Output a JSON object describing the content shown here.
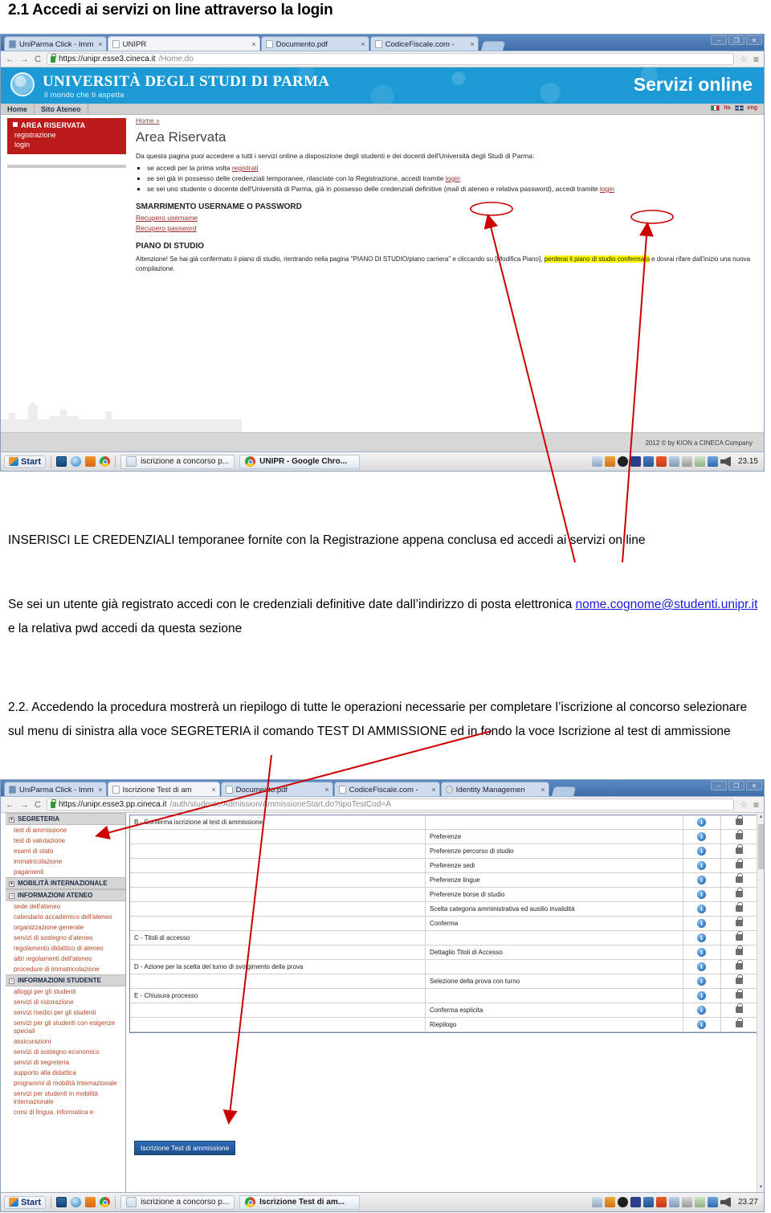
{
  "page": {
    "heading": "2.1 Accedi ai servizi on line attraverso la login"
  },
  "colors": {
    "accent_red": "#bb1b1b",
    "banner_blue": "#1b9ad6",
    "link_red": "#9b2d2d",
    "annotation_red": "#cc0000",
    "highlight_yellow": "#ffff00",
    "button_blue": "#2f6db5"
  },
  "screenshot1": {
    "tabs": [
      {
        "title": "UniParma Click - Imm",
        "close": "×",
        "favicon": "image-icon",
        "active": false
      },
      {
        "title": "UNIPR",
        "close": "×",
        "favicon": "document-icon",
        "active": true
      },
      {
        "title": "Documento.pdf",
        "close": "×",
        "favicon": "document-icon",
        "active": false
      },
      {
        "title": "CodiceFiscale.com -",
        "close": "×",
        "favicon": "document-icon",
        "active": false
      }
    ],
    "window_controls": {
      "minimize": "–",
      "maximize": "❐",
      "close": "✕"
    },
    "nav": {
      "back": "←",
      "forward": "→",
      "reload": "C"
    },
    "url": {
      "scheme_host": "https://unipr.esse3.cineca.it",
      "path": "/Home.do",
      "lock": "lock-icon"
    },
    "bookmark_star": "☆",
    "chrome_menu": "≡",
    "site": {
      "university": "UNIVERSITÀ DEGLI STUDI DI PARMA",
      "tagline": "il mondo che ti aspetta",
      "servizi": "Servizi online",
      "nav_items": [
        "Home",
        "Sito Ateneo"
      ],
      "lang_it": "ita",
      "lang_en": "eng",
      "sidebar": {
        "title": "AREA RISERVATA",
        "items": [
          "registrazione",
          "login"
        ]
      },
      "breadcrumb": "Home »",
      "page_title": "Area Riservata",
      "intro": "Da questa pagina puoi accedere a tutti i servizi online a disposizione degli studenti e dei docenti dell'Università degli Studi di Parma:",
      "bullets": [
        {
          "pre": "se accedi per la prima volta ",
          "link": "registrati",
          "post": ""
        },
        {
          "pre": "se sei già in possesso delle credenziali temporanee, rilasciate con la Registrazione, accedi tramite ",
          "link": "login",
          "post": ""
        },
        {
          "pre": "se sei uno studente o docente dell'Università di Parma, già in possesso delle credenziali definitive (mail di ateneo e relativa password), accedi tramite ",
          "link": "login",
          "post": ""
        }
      ],
      "section_smarrimento": "SMARRIMENTO USERNAME O PASSWORD",
      "recovery_links": [
        "Recupero username",
        "Recupero password"
      ],
      "section_piano": "PIANO DI STUDIO",
      "attention_pre": "Attenzione! Se hai già confermato il piano di studio, rientrando nella pagina \"PIANO DI STUDIO/piano carriera\" e cliccando su [Modifica Piano], ",
      "attention_highlight": "perderai il piano di studio confermato",
      "attention_post": " e dovrai rifare dall'inizio una nuova compilazione.",
      "footer": "2012 © by KION a CINECA Company"
    },
    "taskbar": {
      "start": "Start",
      "quick_launch": [
        "show-desktop-icon",
        "internet-explorer-icon",
        "media-player-icon",
        "chrome-icon"
      ],
      "items": [
        {
          "label": "iscrizione a concorso p...",
          "icon": "word-document-icon",
          "active": false
        },
        {
          "label": "UNIPR - Google Chro...",
          "icon": "chrome-icon",
          "active": true
        }
      ],
      "clock": "23.15"
    }
  },
  "body_text": {
    "para1": "INSERISCI LE CREDENZIALI temporanee fornite con la Registrazione appena conclusa ed accedi ai servizi on line",
    "para2_pre": "Se sei un utente già registrato accedi con le credenziali definitive date dall’indirizzo di posta elettronica ",
    "para2_link": "nome.cognome@studenti.unipr.it",
    "para2_post": " e la relativa pwd accedi da questa sezione",
    "para3": "2.2. Accedendo la procedura mostrerà un riepilogo di tutte le operazioni necessarie per completare l’iscrizione al concorso selezionare sul menu di sinistra alla voce SEGRETERIA il comando TEST DI AMMISSIONE ed in fondo la voce Iscrizione al test di ammissione"
  },
  "screenshot2": {
    "tabs": [
      {
        "title": "UniParma Click - Imm",
        "close": "×",
        "favicon": "image-icon",
        "active": false
      },
      {
        "title": "Iscrizione Test di am",
        "close": "×",
        "favicon": "document-icon",
        "active": true
      },
      {
        "title": "Documento.pdf",
        "close": "×",
        "favicon": "document-icon",
        "active": false
      },
      {
        "title": "CodiceFiscale.com -",
        "close": "×",
        "favicon": "document-icon",
        "active": false
      },
      {
        "title": "Identity Managemen",
        "close": "×",
        "favicon": "identity-icon",
        "active": false
      }
    ],
    "window_controls": {
      "minimize": "–",
      "maximize": "❐",
      "close": "✕"
    },
    "nav": {
      "back": "←",
      "forward": "→",
      "reload": "C"
    },
    "url": {
      "scheme_host": "https://unipr.esse3.pp.cineca.it",
      "path": "/auth/studente/Admission/AmmissioneStart.do?tipoTestCod=A",
      "lock": "lock-icon"
    },
    "bookmark_star": "☆",
    "chrome_menu": "≡",
    "sidebar_groups": [
      {
        "title": "SEGRETERIA",
        "toggle": "+",
        "items": [
          "test di ammissione",
          "test di valutazione",
          "esami di stato",
          "immatricolazione",
          "pagamenti"
        ]
      },
      {
        "title": "MOBILITÀ INTERNAZIONALE",
        "toggle": "+",
        "items": []
      },
      {
        "title": "INFORMAZIONI ATENEO",
        "toggle": "-",
        "items": [
          "sede dell'ateneo",
          "calendario accademico dell'ateneo",
          "organizzazione generale",
          "servizi di sostegno d'ateneo",
          "regolamento didattico di ateneo",
          "altri regolamenti dell'ateneo",
          "procedure di immatricolazione"
        ]
      },
      {
        "title": "INFORMAZIONI STUDENTE",
        "toggle": "-",
        "items": [
          "alloggi per gli studenti",
          "servizi di ristorazione",
          "servizi medici per gli studenti",
          "servizi per gli studenti con esigenze speciali",
          "assicurazioni",
          "servizi di sostegno economico",
          "servizi di segreteria",
          "supporto alla didattica",
          "programmi di mobilità internazionale",
          "servizi per studenti in mobilità internazionale",
          "corsi di lingua, informatica e"
        ]
      }
    ],
    "table": {
      "rows": [
        {
          "c1": "B - Conferma iscrizione al test di ammissione",
          "c2": "",
          "info": "i",
          "lock": "lock-icon"
        },
        {
          "c1": "",
          "c2": "Preferenze",
          "info": "i",
          "lock": "lock-icon"
        },
        {
          "c1": "",
          "c2": "Preferenze percorso di studio",
          "info": "i",
          "lock": "lock-icon"
        },
        {
          "c1": "",
          "c2": "Preferenze sedi",
          "info": "i",
          "lock": "lock-icon"
        },
        {
          "c1": "",
          "c2": "Preferenze lingue",
          "info": "i",
          "lock": "lock-icon"
        },
        {
          "c1": "",
          "c2": "Preferenze borse di studio",
          "info": "i",
          "lock": "lock-icon"
        },
        {
          "c1": "",
          "c2": "Scelta categoria amministrativa ed ausilio invalidità",
          "info": "i",
          "lock": "lock-icon"
        },
        {
          "c1": "",
          "c2": "Conferma",
          "info": "i",
          "lock": "lock-icon"
        },
        {
          "c1": "C - Titoli di accesso",
          "c2": "",
          "info": "i",
          "lock": "lock-icon"
        },
        {
          "c1": "",
          "c2": "Dettaglio Titoli di Accesso",
          "info": "i",
          "lock": "lock-icon"
        },
        {
          "c1": "D - Azione per la scelta del turno di svolgimento della prova",
          "c2": "",
          "info": "i",
          "lock": "lock-icon"
        },
        {
          "c1": "",
          "c2": "Selezione della prova con turno",
          "info": "i",
          "lock": "lock-icon"
        },
        {
          "c1": "E - Chiusura processo",
          "c2": "",
          "info": "i",
          "lock": "lock-icon"
        },
        {
          "c1": "",
          "c2": "Conferma esplicita",
          "info": "i",
          "lock": "lock-icon"
        },
        {
          "c1": "",
          "c2": "Riepilogo",
          "info": "i",
          "lock": "lock-icon"
        }
      ],
      "submit_button": "Iscrizione Test di ammissione"
    },
    "taskbar": {
      "start": "Start",
      "quick_launch": [
        "show-desktop-icon",
        "internet-explorer-icon",
        "media-player-icon",
        "chrome-icon"
      ],
      "items": [
        {
          "label": "iscrizione a concorso p...",
          "icon": "word-document-icon",
          "active": false
        },
        {
          "label": "Iscrizione Test di am...",
          "icon": "chrome-icon",
          "active": true
        }
      ],
      "clock": "23.27"
    }
  }
}
